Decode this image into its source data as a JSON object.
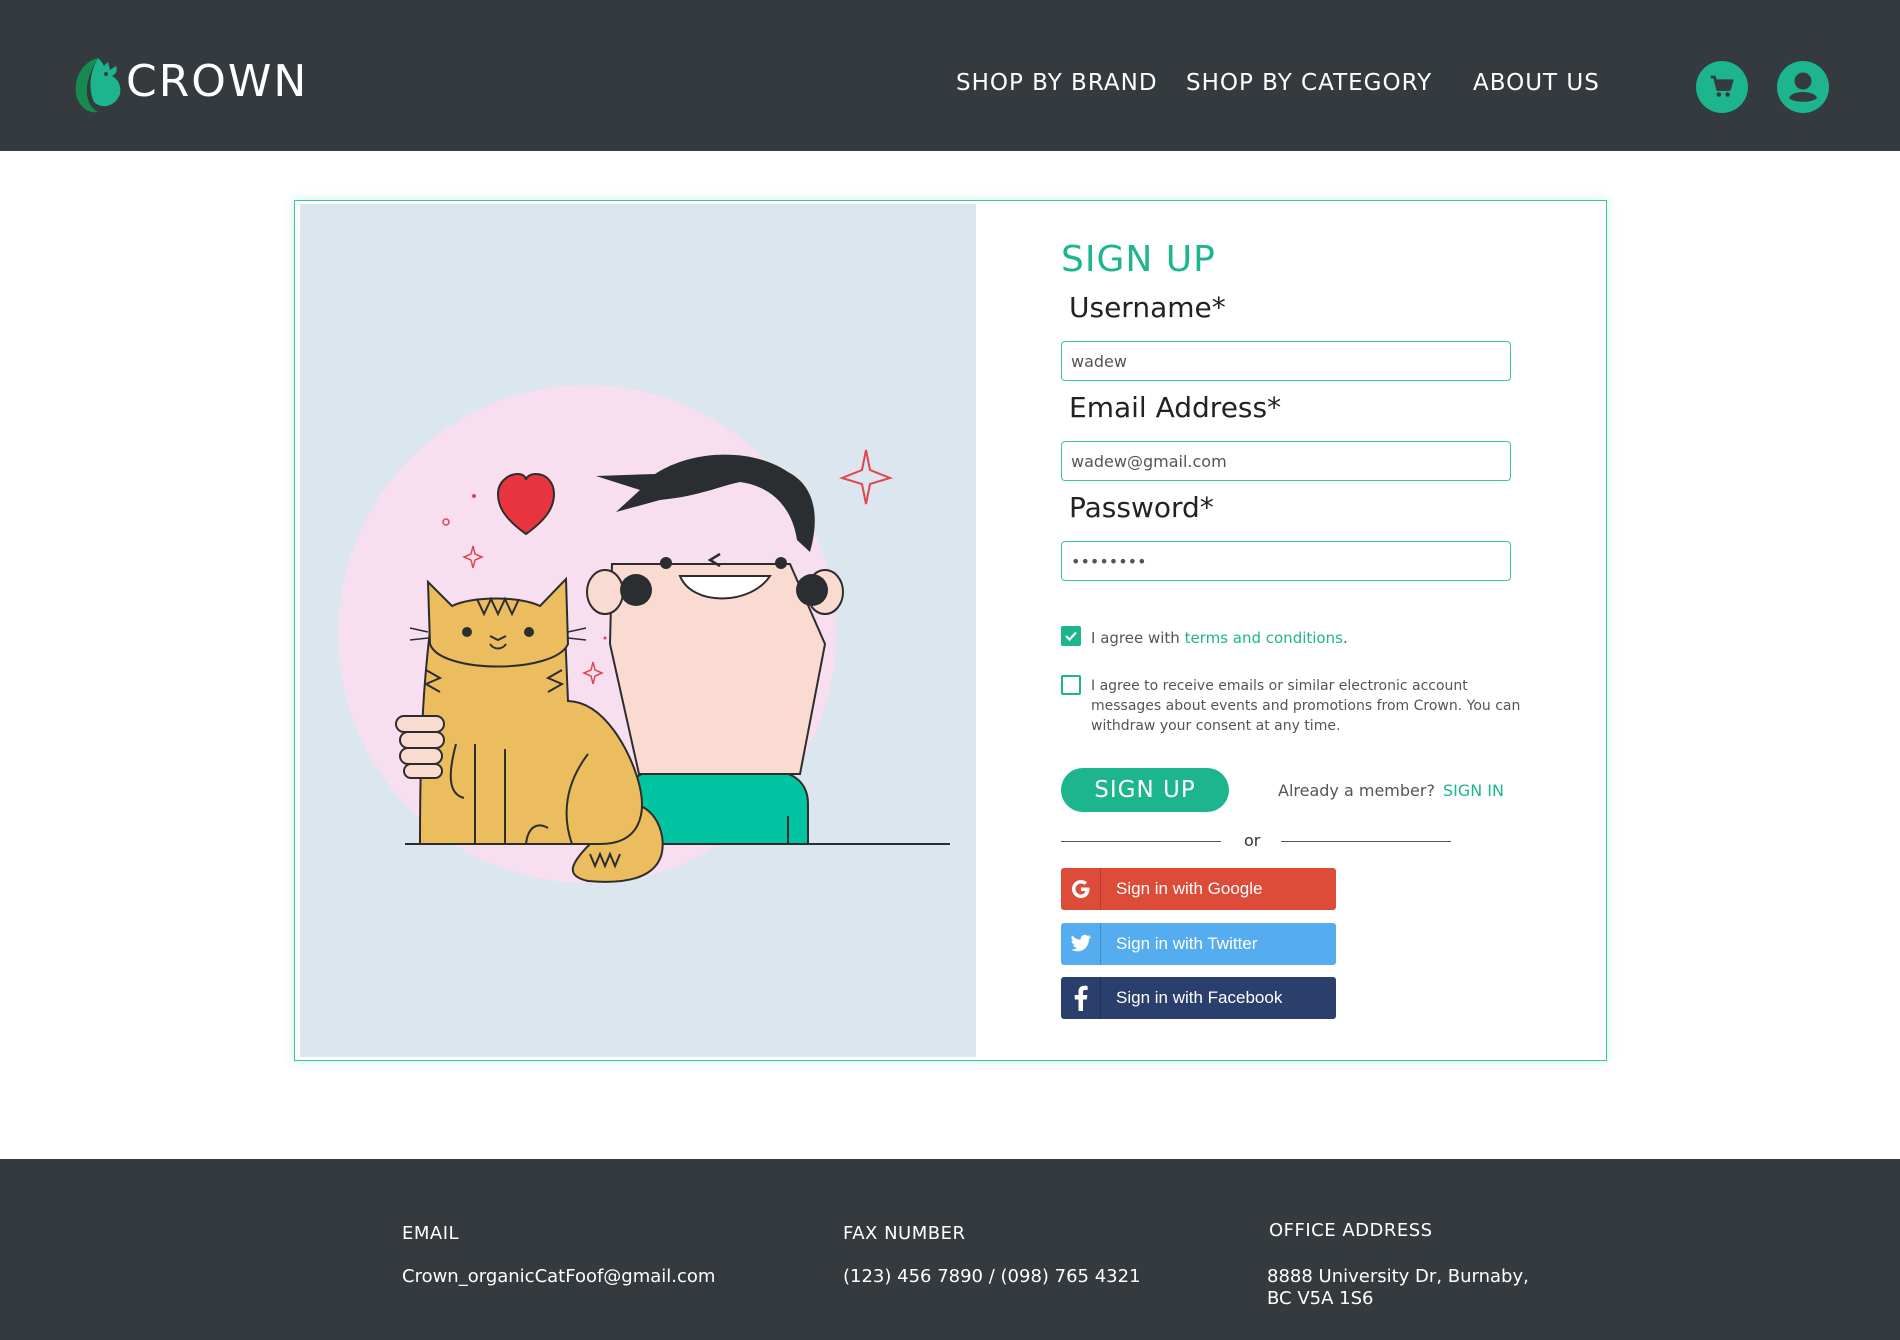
{
  "header": {
    "logo_text": "CROWN",
    "nav": {
      "brand": "SHOP BY BRAND",
      "category": "SHOP BY CATEGORY",
      "about": "ABOUT US"
    },
    "icons": {
      "cart": "cart-icon",
      "account": "user-icon"
    },
    "accent_color": "#1db58e",
    "background_color": "#343a3e"
  },
  "form": {
    "title": "SIGN UP",
    "username": {
      "label": "Username*",
      "value": "wadew"
    },
    "email": {
      "label": "Email Address*",
      "value": "wadew@gmail.com"
    },
    "password": {
      "label": "Password*",
      "value": "••••••••"
    },
    "terms": {
      "checked": true,
      "prefix": "I agree with ",
      "link": "terms and conditions",
      "suffix": "."
    },
    "marketing": {
      "checked": false,
      "text": "I agree to receive emails or similar electronic account messages about events and promotions from Crown. You can withdraw your consent at any time."
    },
    "submit_label": "SIGN UP",
    "member_text": "Already a member?",
    "signin_link": "SIGN IN",
    "or_text": "or",
    "social": {
      "google": "Sign in with Google",
      "twitter": "Sign in with Twitter",
      "facebook": "Sign in with Facebook"
    },
    "colors": {
      "google": "#dd4b39",
      "twitter": "#55acee",
      "facebook": "#2b3f6c"
    }
  },
  "footer": {
    "email_heading": "EMAIL",
    "email_value": "Crown_organicCatFoof@gmail.com",
    "fax_heading": "FAX NUMBER",
    "fax_value": "(123) 456 7890 / (098) 765 4321",
    "address_heading": "OFFICE ADDRESS",
    "address_line1": "8888 University Dr, Burnaby,",
    "address_line2": "BC V5A 1S6"
  }
}
